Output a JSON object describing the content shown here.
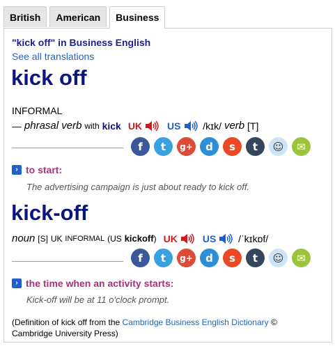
{
  "tabs": [
    "British",
    "American",
    "Business"
  ],
  "header": {
    "title": "\"kick off\" in Business English",
    "see_all": "See all translations"
  },
  "entry1": {
    "headword": "kick off",
    "register": "INFORMAL",
    "dash": "—",
    "pos": "phrasal verb",
    "with": "with",
    "with_word": "kick",
    "uk": "UK",
    "us": "US",
    "pron": "/kɪk/",
    "pos2": "verb",
    "grammar": "[T]",
    "definition": "to start:",
    "example": "The advertising campaign is just about ready to kick off."
  },
  "entry2": {
    "headword": "kick-off",
    "pos": "noun",
    "grammar": "[S]",
    "region": "UK",
    "register": "INFORMAL",
    "us_open": "(US",
    "us_word": "kickoff",
    "us_close": ")",
    "uk": "UK",
    "us": "US",
    "pron": "/ˈkɪkɒf/",
    "definition": "the time when an activity starts:",
    "example": "Kick-off will be at 11 o'clock prompt."
  },
  "footer": {
    "prefix": "(Definition of kick off from the",
    "link": "Cambridge Business English Dictionary",
    "suffix": "© Cambridge University Press)"
  },
  "social_icons": [
    "facebook-icon",
    "twitter-icon",
    "google-plus-icon",
    "diigo-icon",
    "stumbleupon-icon",
    "tumblr-icon",
    "reddit-icon",
    "email-icon"
  ],
  "colors": {
    "headword": "#0b1580",
    "definition": "#a8327a",
    "link": "#1a66cc",
    "uk": "#d11919",
    "us": "#2060c0"
  }
}
